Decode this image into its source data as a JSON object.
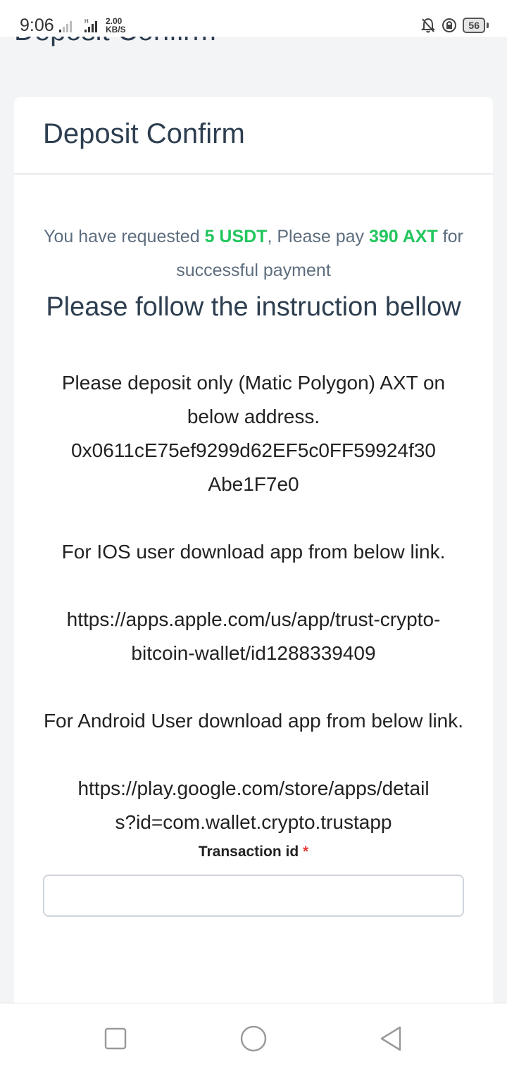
{
  "status": {
    "time": "9:06",
    "net_speed_value": "2.00",
    "net_speed_unit": "KB/S",
    "battery": "56"
  },
  "page": {
    "bg_title": "Deposit Confirm"
  },
  "card": {
    "title": "Deposit Confirm",
    "request": {
      "prefix": "You have requested ",
      "amount": "5 USDT",
      "middle": ", Please pay ",
      "pay_amount_num": "390",
      "pay_amount_unit": "AXT",
      "suffix": " for successful payment"
    },
    "instruction_heading": "Please follow the instruction bellow",
    "deposit_text": "Please deposit only (Matic Polygon) AXT on below address.",
    "address_line1": "0x0611cE75ef9299d62EF5c0FF59924f30",
    "address_line2": "Abe1F7e0",
    "ios_text": "For IOS user download app from below link.",
    "ios_link": "https://apps.apple.com/us/app/trust-crypto-bitcoin-wallet/id1288339409",
    "android_text": "For Android User download app from below link.",
    "android_link_line1": "https://play.google.com/store/apps/detail",
    "android_link_line2": "s?id=com.wallet.crypto.trustapp",
    "tx_label": "Transaction id",
    "required_mark": "*"
  },
  "nav": {
    "recents_icon": "square-icon",
    "home_icon": "circle-icon",
    "back_icon": "triangle-back-icon"
  },
  "colors": {
    "accent_green": "#22c55e",
    "heading": "#2d3e50",
    "required": "#e53935"
  }
}
